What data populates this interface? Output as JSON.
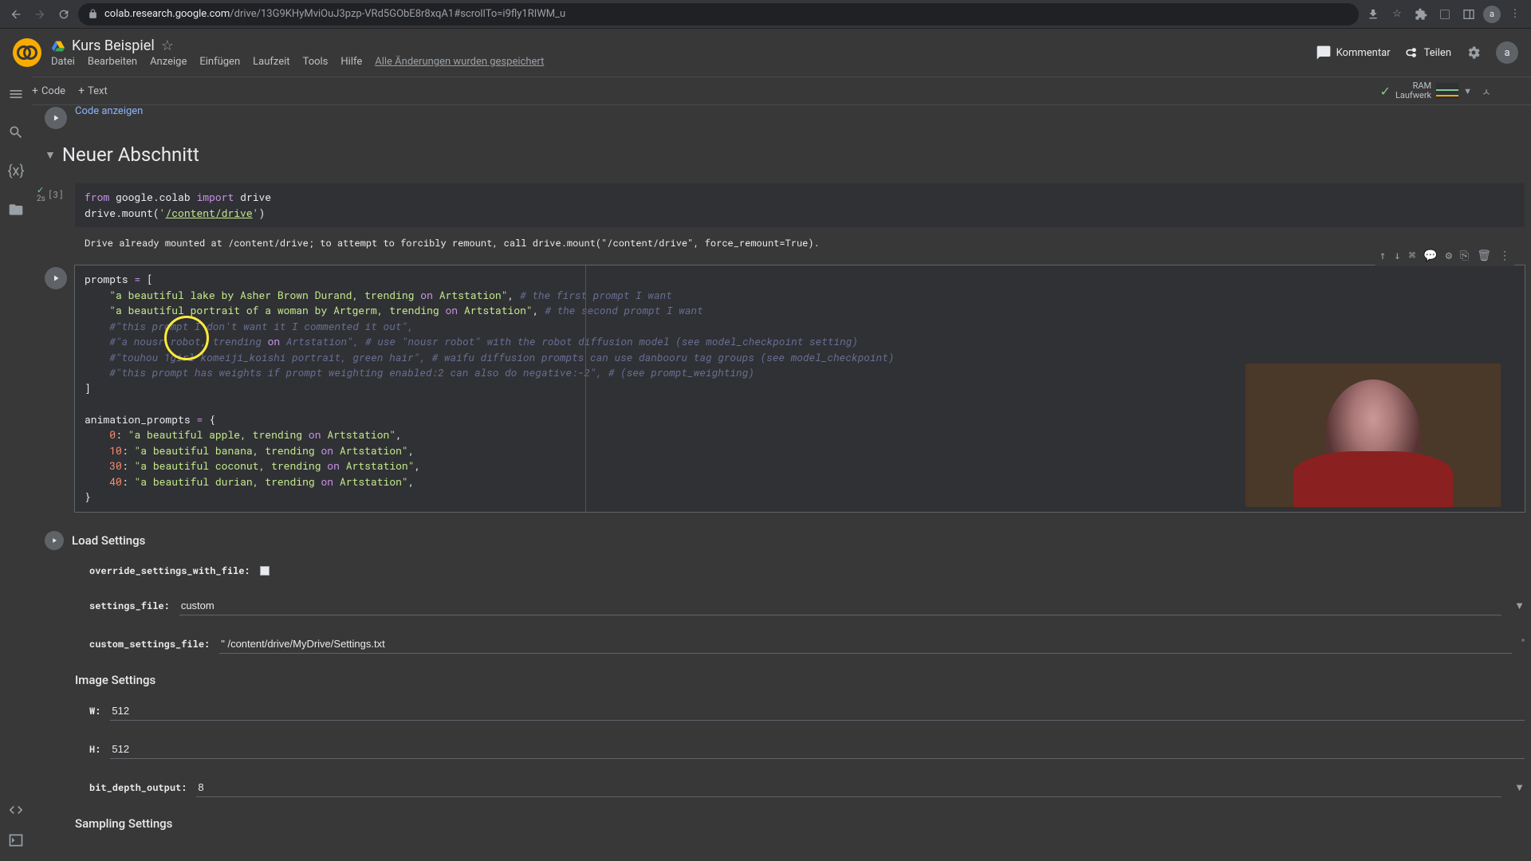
{
  "browser": {
    "url_secure": "colab.research.google.com",
    "url_path": "/drive/13G9KHyMviOuJ3pzp-VRd5GObE8r8xqA1#scrollTo=i9fly1RIWM_u",
    "avatar_letter": "a"
  },
  "header": {
    "title": "Kurs Beispiel",
    "menu": {
      "file": "Datei",
      "edit": "Bearbeiten",
      "view": "Anzeige",
      "insert": "Einfügen",
      "runtime": "Laufzeit",
      "tools": "Tools",
      "help": "Hilfe",
      "saved": "Alle Änderungen wurden gespeichert"
    },
    "comment_btn": "Kommentar",
    "share_btn": "Teilen",
    "avatar_letter": "a"
  },
  "toolbar": {
    "code_btn": "Code",
    "text_btn": "Text",
    "runtime": {
      "ram": "RAM",
      "disk": "Laufwerk"
    }
  },
  "collapsed_cell": {
    "show_code": "Code anzeigen"
  },
  "section": {
    "title": "Neuer Abschnitt"
  },
  "cell_mount": {
    "index": "[3]",
    "exec_time": "2s",
    "output": "Drive already mounted at /content/drive; to attempt to forcibly remount, call drive.mount(\"/content/drive\", force_remount=True)."
  },
  "load_settings": {
    "heading": "Load Settings",
    "override_label": "override_settings_with_file:",
    "settings_file_label": "settings_file:",
    "settings_file_value": "custom",
    "custom_label": "custom_settings_file:",
    "custom_value": "\" /content/drive/MyDrive/Settings.txt",
    "custom_quote_end": "\""
  },
  "image_settings": {
    "heading": "Image Settings",
    "w_label": "W:",
    "w_value": "512",
    "h_label": "H:",
    "h_value": "512",
    "bit_label": "bit_depth_output:",
    "bit_value": "8"
  },
  "sampling": {
    "heading": "Sampling Settings"
  }
}
